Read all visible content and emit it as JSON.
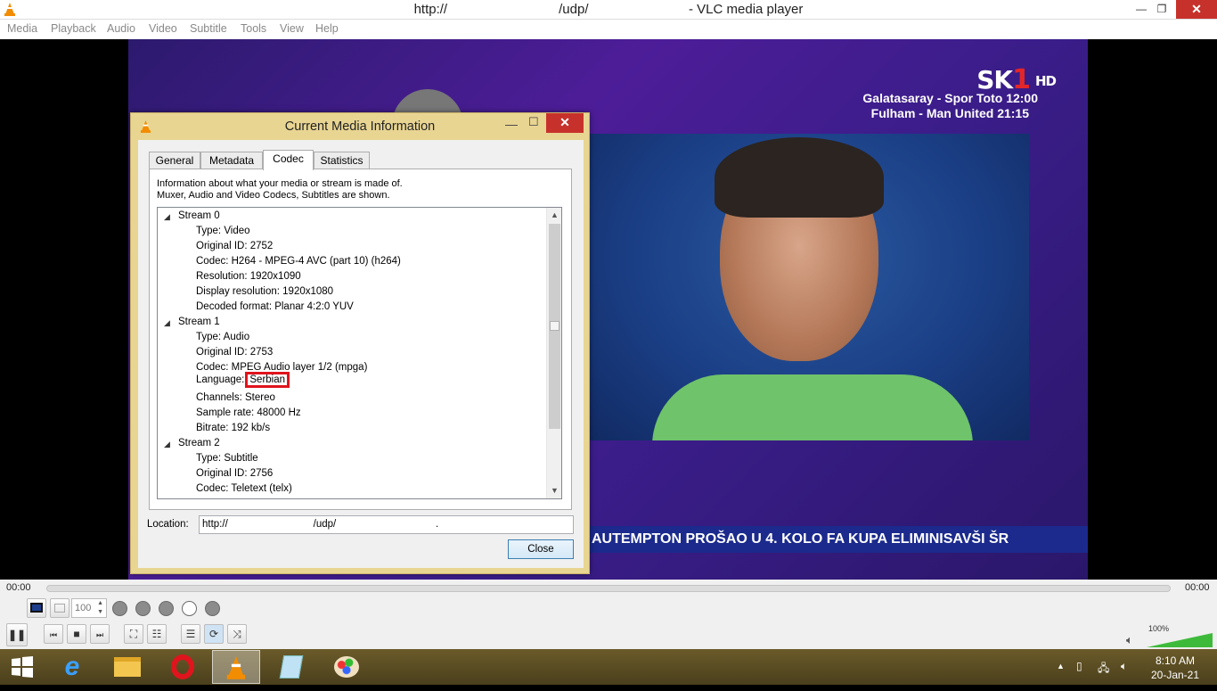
{
  "window": {
    "title": "http://                              /udp/                           - VLC media player",
    "minimize": "—",
    "restore": "❐",
    "close": "✕"
  },
  "menu": [
    "Media",
    "Playback",
    "Audio",
    "Video",
    "Subtitle",
    "Tools",
    "View",
    "Help"
  ],
  "video": {
    "channel_logo": "SK",
    "channel_logo_num": "1",
    "channel_logo_hd": "HD",
    "schedule": [
      "Galatasaray - Spor Toto  12:00",
      "Fulham - Man United  21:15"
    ],
    "ticker": "AUTEMPTON PROŠAO U 4. KOLO FA KUPA ELIMINISAVŠI ŠR"
  },
  "dialog": {
    "title": "Current Media Information",
    "minimize": "—",
    "maximize": "☐",
    "close": "✕",
    "tabs": [
      "General",
      "Metadata",
      "Codec",
      "Statistics"
    ],
    "active_tab": "Codec",
    "description_line1": "Information about what your media or stream is made of.",
    "description_line2": "Muxer, Audio and Video Codecs, Subtitles are shown.",
    "tree": [
      {
        "label": "Stream 0",
        "level": 0
      },
      {
        "label": "Type: Video",
        "level": 1
      },
      {
        "label": "Original ID: 2752",
        "level": 1
      },
      {
        "label": "Codec: H264 - MPEG-4 AVC (part 10) (h264)",
        "level": 1
      },
      {
        "label": "Resolution: 1920x1090",
        "level": 1
      },
      {
        "label": "Display resolution: 1920x1080",
        "level": 1
      },
      {
        "label": "Decoded format: Planar 4:2:0 YUV",
        "level": 1
      },
      {
        "label": "Stream 1",
        "level": 0
      },
      {
        "label": "Type: Audio",
        "level": 1
      },
      {
        "label": "Original ID: 2753",
        "level": 1
      },
      {
        "label": "Codec: MPEG Audio layer 1/2 (mpga)",
        "level": 1
      },
      {
        "label": "Language:",
        "value": "Serbian",
        "level": 1,
        "highlight": true
      },
      {
        "label": "Channels: Stereo",
        "level": 1
      },
      {
        "label": "Sample rate: 48000 Hz",
        "level": 1
      },
      {
        "label": "Bitrate: 192 kb/s",
        "level": 1
      },
      {
        "label": "Stream 2",
        "level": 0
      },
      {
        "label": "Type: Subtitle",
        "level": 1
      },
      {
        "label": "Original ID: 2756",
        "level": 1
      },
      {
        "label": "Codec: Teletext (telx)",
        "level": 1
      }
    ],
    "location_label": "Location:",
    "location_value": "http://                              /udp/                                   .",
    "close_button": "Close"
  },
  "controls": {
    "time_elapsed": "00:00",
    "time_total": "00:00",
    "zoom_value": "100",
    "volume_percent": "100%"
  },
  "taskbar": {
    "time": "8:10 AM",
    "date": "20-Jan-21"
  },
  "colors": {
    "dialog_frame": "#e8d592",
    "highlight_box": "#e0141d",
    "close_red": "#c7312b",
    "volume_green": "#3dba3a"
  }
}
